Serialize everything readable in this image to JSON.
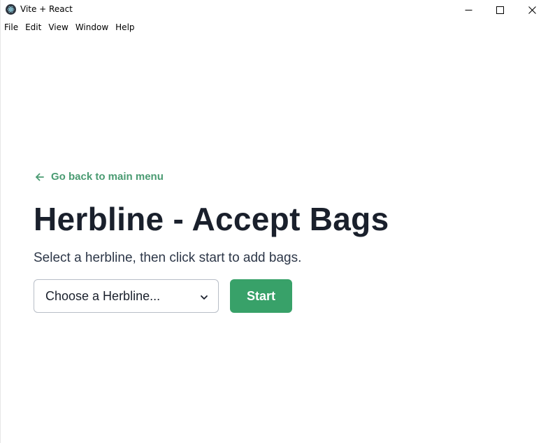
{
  "window": {
    "title": "Vite + React",
    "app_icon": "electron-icon",
    "controls": {
      "minimize_icon": "minimize-icon",
      "maximize_icon": "maximize-icon",
      "close_icon": "close-icon"
    }
  },
  "menubar": {
    "items": [
      {
        "label": "File"
      },
      {
        "label": "Edit"
      },
      {
        "label": "View"
      },
      {
        "label": "Window"
      },
      {
        "label": "Help"
      }
    ]
  },
  "main": {
    "back_link": {
      "label": "Go back to main menu",
      "icon": "arrow-left-icon"
    },
    "title": "Herbline - Accept Bags",
    "subtitle": "Select a herbline, then click start to add bags.",
    "herbline_select": {
      "selected": "Choose a Herbline...",
      "icon": "chevron-down-icon"
    },
    "start_button": {
      "label": "Start"
    }
  },
  "colors": {
    "accent_green": "#38a169",
    "link_green": "#4a9b72",
    "heading_text": "#1a202c",
    "body_text": "#2d3748",
    "select_border": "#b8bec7"
  }
}
